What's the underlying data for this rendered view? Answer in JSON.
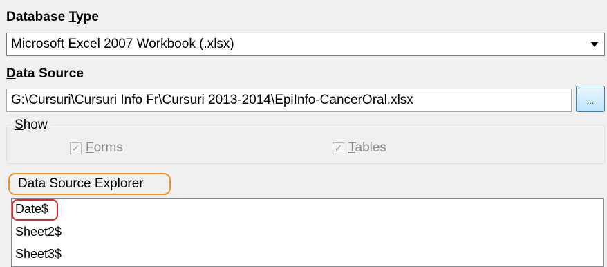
{
  "database_type": {
    "label_pre": "Database ",
    "label_accel": "T",
    "label_post": "ype",
    "selected_value": "Microsoft Excel 2007 Workbook (.xlsx)"
  },
  "data_source": {
    "label_accel": "D",
    "label_post": "ata Source",
    "path_value": "G:\\Cursuri\\Cursuri Info Fr\\Cursuri 2013-2014\\EpiInfo-CancerOral.xlsx",
    "browse_label": "..."
  },
  "show": {
    "legend_accel": "S",
    "legend_post": "how",
    "forms_accel": "F",
    "forms_post": "orms",
    "tables_accel": "T",
    "tables_post": "ables"
  },
  "explorer": {
    "title": "Data Source Explorer",
    "items": [
      "Date$",
      "Sheet2$",
      "Sheet3$"
    ]
  },
  "colors": {
    "orange_highlight": "#f39124",
    "red_highlight": "#e8242a",
    "button_border": "#3c7fb1"
  }
}
